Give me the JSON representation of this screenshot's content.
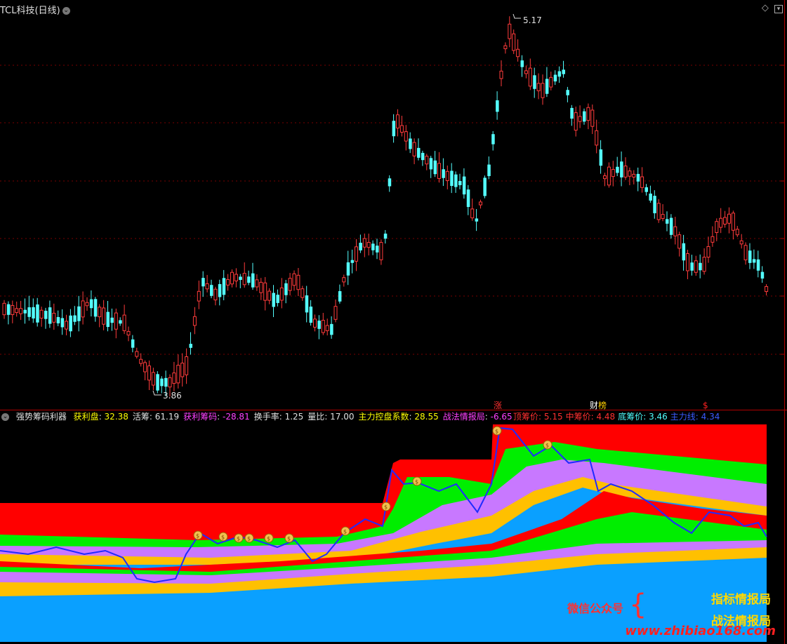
{
  "header": {
    "title": "TCL科技(日线)",
    "right_icons": [
      "diamond-icon",
      "settings-icon"
    ]
  },
  "main_chart": {
    "type": "candlestick",
    "high_label": "5.17",
    "low_label": "3.86",
    "colors": {
      "up": "#ff3b3b",
      "down": "#54ffff",
      "grid": "#7a0000",
      "bg": "#000000"
    },
    "event_marks": [
      {
        "text": "涨",
        "color": "#ff3030"
      },
      {
        "text": "财",
        "color": "#ffffff"
      },
      {
        "text": "榜",
        "color": "#ffd000"
      },
      {
        "text": "$",
        "color": "#ff2020"
      }
    ]
  },
  "sub_chart": {
    "name": "强势筹码利器",
    "indicators": [
      {
        "label": "获利盘",
        "value": "32.38",
        "color": "#ffff00"
      },
      {
        "label": "活筹",
        "value": "61.19",
        "color": "#e0e0e0"
      },
      {
        "label": "获利筹码",
        "value": "-28.81",
        "color": "#ff40ff"
      },
      {
        "label": "换手率",
        "value": "1.25",
        "color": "#e0e0e0"
      },
      {
        "label": "量比",
        "value": "17.00",
        "color": "#e0e0e0"
      },
      {
        "label": "主力控盘系数",
        "value": "28.55",
        "color": "#ffff00"
      },
      {
        "label": "战法情报局",
        "value": "-6.65",
        "color": "#ff40ff"
      }
    ],
    "price_levels": [
      {
        "label": "顶筹价",
        "value": "5.15",
        "color": "#ff3030"
      },
      {
        "label": "中筹价",
        "value": "4.48",
        "color": "#ff3030"
      },
      {
        "label": "底筹价",
        "value": "3.46",
        "color": "#50ffff"
      },
      {
        "label": "主力线",
        "value": "4.34",
        "color": "#3a5bff"
      }
    ],
    "band_colors": [
      "#ff0000",
      "#00ee00",
      "#c878ff",
      "#ffc000",
      "#0aa0ff"
    ],
    "main_line_color": "#1f2bff"
  },
  "watermark": {
    "prefix": "微信公众号",
    "line1": "指标情报局",
    "line2": "战法情报局",
    "url": "www.zhibiao168.com"
  }
}
